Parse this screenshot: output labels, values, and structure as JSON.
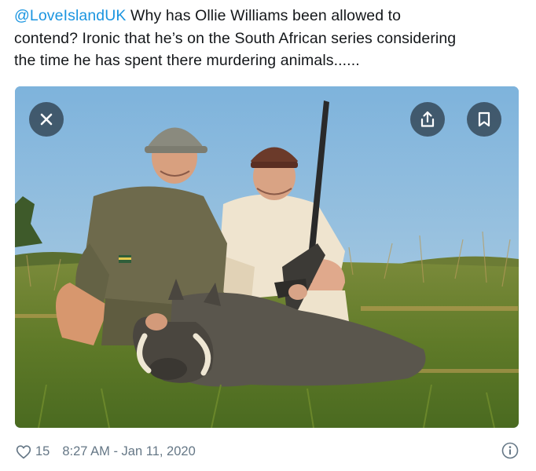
{
  "tweet": {
    "mention": "@LoveIslandUK",
    "text_line1": " Why has Ollie Williams been allowed to",
    "text_line2": "contend? Ironic that he’s on the South African series considering",
    "text_line3": "the time he has spent there murdering animals......"
  },
  "media": {
    "alt": "Two men kneeling behind a dead warthog holding a rifle",
    "close_icon": "close-icon",
    "share_icon": "share-icon",
    "bookmark_icon": "bookmark-icon"
  },
  "footer": {
    "like_icon": "heart-icon",
    "like_count": "15",
    "timestamp": "8:27 AM - Jan 11, 2020",
    "info_icon": "info-icon"
  },
  "colors": {
    "mention": "#1b95e0",
    "meta_text": "#657786",
    "body_text": "#14171a"
  }
}
